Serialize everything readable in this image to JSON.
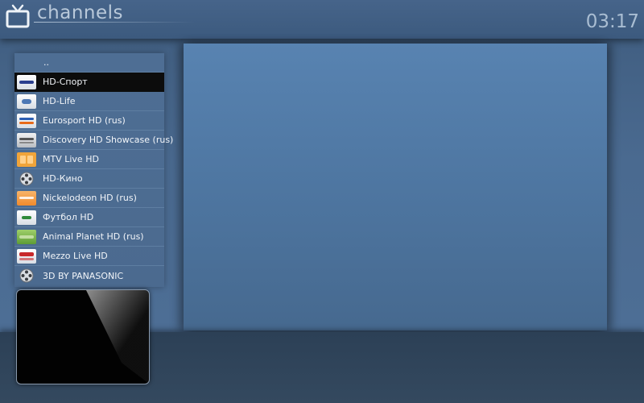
{
  "header": {
    "title": "channels",
    "clock": "03:17"
  },
  "channels": {
    "parent_label": "..",
    "items": [
      {
        "label": "HD-Спорт",
        "icon": "hd-sport-logo-icon",
        "selected": true
      },
      {
        "label": "HD-Life",
        "icon": "hd-life-logo-icon"
      },
      {
        "label": "Eurosport HD (rus)",
        "icon": "eurosport-logo-icon"
      },
      {
        "label": "Discovery HD Showcase (rus)",
        "icon": "discovery-logo-icon"
      },
      {
        "label": "MTV Live HD",
        "icon": "mtv-logo-icon"
      },
      {
        "label": "HD-Кино",
        "icon": "film-reel-icon"
      },
      {
        "label": "Nickelodeon HD (rus)",
        "icon": "nickelodeon-logo-icon"
      },
      {
        "label": "Футбол HD",
        "icon": "football-logo-icon"
      },
      {
        "label": "Animal Planet HD (rus)",
        "icon": "animal-planet-logo-icon"
      },
      {
        "label": "Mezzo Live HD",
        "icon": "mezzo-logo-icon"
      },
      {
        "label": "3D BY PANASONIC",
        "icon": "film-reel-icon"
      }
    ]
  },
  "colors": {
    "background": "#4a6a90",
    "selected_row": "#0c0c0c",
    "text": "#f2f5f9",
    "header_text": "#b9c9da"
  }
}
